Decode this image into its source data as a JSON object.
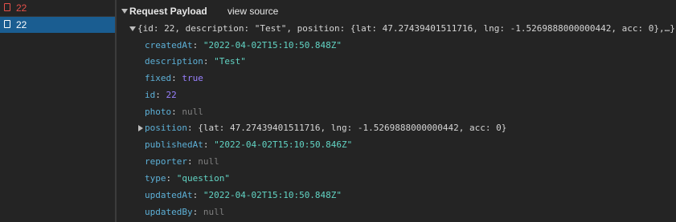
{
  "requests": [
    {
      "name": "22",
      "status": "error"
    },
    {
      "name": "22",
      "status": "selected"
    }
  ],
  "payload": {
    "section_title": "Request Payload",
    "view_source_label": "view source",
    "summary": "{id: 22, description: \"Test\", position: {lat: 47.27439401511716, lng: -1.5269888000000442, acc: 0},…}",
    "properties": [
      {
        "key": "createdAt",
        "value": "\"2022-04-02T15:10:50.848Z\"",
        "type": "string"
      },
      {
        "key": "description",
        "value": "\"Test\"",
        "type": "string"
      },
      {
        "key": "fixed",
        "value": "true",
        "type": "bool"
      },
      {
        "key": "id",
        "value": "22",
        "type": "number"
      },
      {
        "key": "photo",
        "value": "null",
        "type": "null"
      },
      {
        "key": "position",
        "value": "{lat: 47.27439401511716, lng: -1.5269888000000442, acc: 0}",
        "type": "object"
      },
      {
        "key": "publishedAt",
        "value": "\"2022-04-02T15:10:50.846Z\"",
        "type": "string"
      },
      {
        "key": "reporter",
        "value": "null",
        "type": "null"
      },
      {
        "key": "type",
        "value": "\"question\"",
        "type": "string"
      },
      {
        "key": "updatedAt",
        "value": "\"2022-04-02T15:10:50.848Z\"",
        "type": "string"
      },
      {
        "key": "updatedBy",
        "value": "null",
        "type": "null"
      }
    ]
  },
  "colors": {
    "error_text": "#e6504a",
    "selected_bg": "#1a5d91",
    "key": "#5db0d7",
    "string": "#62d4c4",
    "number": "#9980ff",
    "null": "#7f7f7f"
  }
}
